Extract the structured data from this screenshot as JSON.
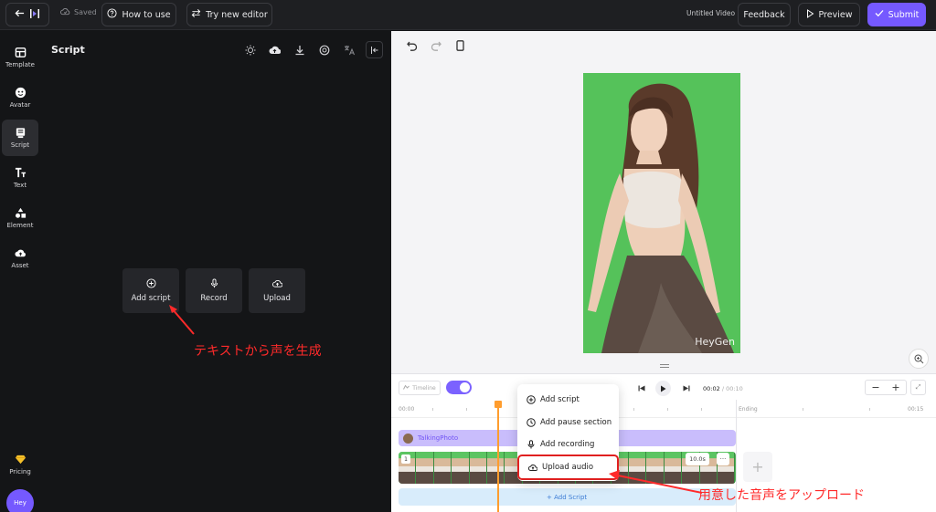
{
  "topbar": {
    "saved_label": "Saved",
    "how_to_use": "How to use",
    "try_new_editor": "Try new editor",
    "video_title": "Untitled Video",
    "feedback": "Feedback",
    "preview": "Preview",
    "submit": "Submit"
  },
  "leftnav": {
    "items": [
      {
        "label": "Template",
        "icon": "template-icon"
      },
      {
        "label": "Avatar",
        "icon": "avatar-icon"
      },
      {
        "label": "Script",
        "icon": "script-icon"
      },
      {
        "label": "Text",
        "icon": "text-icon"
      },
      {
        "label": "Element",
        "icon": "element-icon"
      },
      {
        "label": "Asset",
        "icon": "asset-icon"
      }
    ],
    "active": "Script",
    "pricing": "Pricing",
    "user_avatar": "Hey"
  },
  "script_panel": {
    "title": "Script",
    "actions": {
      "add_script": "Add script",
      "record": "Record",
      "upload": "Upload"
    }
  },
  "annotations": {
    "left": "テキストから声を生成",
    "right": "用意した音声をアップロード"
  },
  "preview": {
    "watermark": "HeyGen"
  },
  "timeline": {
    "mode_label": "Timeline",
    "current_time": "00:02",
    "total_time": "/ 00:10",
    "ruler_start": "00:00",
    "ruler_end_label": "Ending",
    "ruler_right": "00:15",
    "talking_photo_track": "TalkingPhoto",
    "clip_number": "1",
    "clip_duration": "10.0s",
    "more": "···",
    "add_script": "Add Script"
  },
  "menu": {
    "items": [
      {
        "label": "Add script",
        "icon": "plus-circle-icon"
      },
      {
        "label": "Add pause section",
        "icon": "pause-clock-icon"
      },
      {
        "label": "Add recording",
        "icon": "microphone-icon"
      },
      {
        "label": "Upload audio",
        "icon": "cloud-upload-icon"
      }
    ],
    "highlighted": "Upload audio"
  },
  "colors": {
    "accent": "#7559ff",
    "annotation": "#ff2a2a",
    "playhead": "#ff9d2e",
    "photo_bg": "#55c25a"
  }
}
